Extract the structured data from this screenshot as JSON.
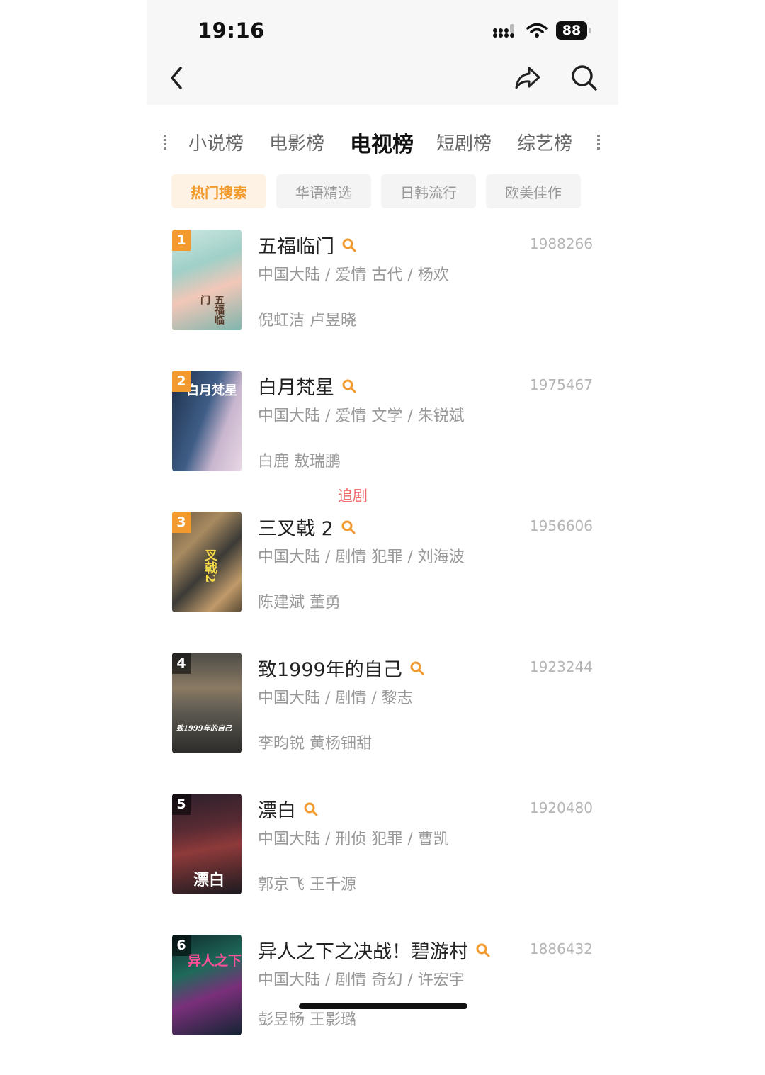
{
  "status_bar": {
    "time": "19:16",
    "battery": "88"
  },
  "nav": {
    "back_icon": "chevron-left-icon",
    "share_icon": "share-icon",
    "search_icon": "search-icon"
  },
  "main_tabs": [
    "小说榜",
    "电影榜",
    "电视榜",
    "短剧榜",
    "综艺榜"
  ],
  "main_tabs_active": "电视榜",
  "sub_tabs": [
    "热门搜索",
    "华语精选",
    "日韩流行",
    "欧美佳作"
  ],
  "sub_tabs_active": "热门搜索",
  "accent_color": "#f29a2e",
  "floating_label": "追剧",
  "items": [
    {
      "rank": "1",
      "title": "五福临门",
      "score": "1988266",
      "meta": "中国大陆 / 爱情 古代 / 杨欢",
      "cast": "倪虹洁 卢昱晓",
      "poster_text": "五福临门"
    },
    {
      "rank": "2",
      "title": "白月梵星",
      "score": "1975467",
      "meta": "中国大陆 / 爱情 文学 / 朱锐斌",
      "cast": "白鹿 敖瑞鹏",
      "poster_text": "白月梵星"
    },
    {
      "rank": "3",
      "title": "三叉戟 2",
      "score": "1956606",
      "meta": "中国大陆 / 剧情 犯罪 / 刘海波",
      "cast": "陈建斌 董勇",
      "poster_text": "叉戟2"
    },
    {
      "rank": "4",
      "title": "致1999年的自己",
      "score": "1923244",
      "meta": "中国大陆 / 剧情 / 黎志",
      "cast": "李昀锐 黄杨钿甜",
      "poster_text": "致1999年的自己"
    },
    {
      "rank": "5",
      "title": "漂白",
      "score": "1920480",
      "meta": "中国大陆 / 刑侦 犯罪 / 曹凯",
      "cast": "郭京飞 王千源",
      "poster_text": "漂白"
    },
    {
      "rank": "6",
      "title": "异人之下之决战！碧游村",
      "score": "1886432",
      "meta": "中国大陆 / 剧情 奇幻 / 许宏宇",
      "cast": "彭昱畅 王影璐",
      "poster_text": "异人之下"
    }
  ]
}
